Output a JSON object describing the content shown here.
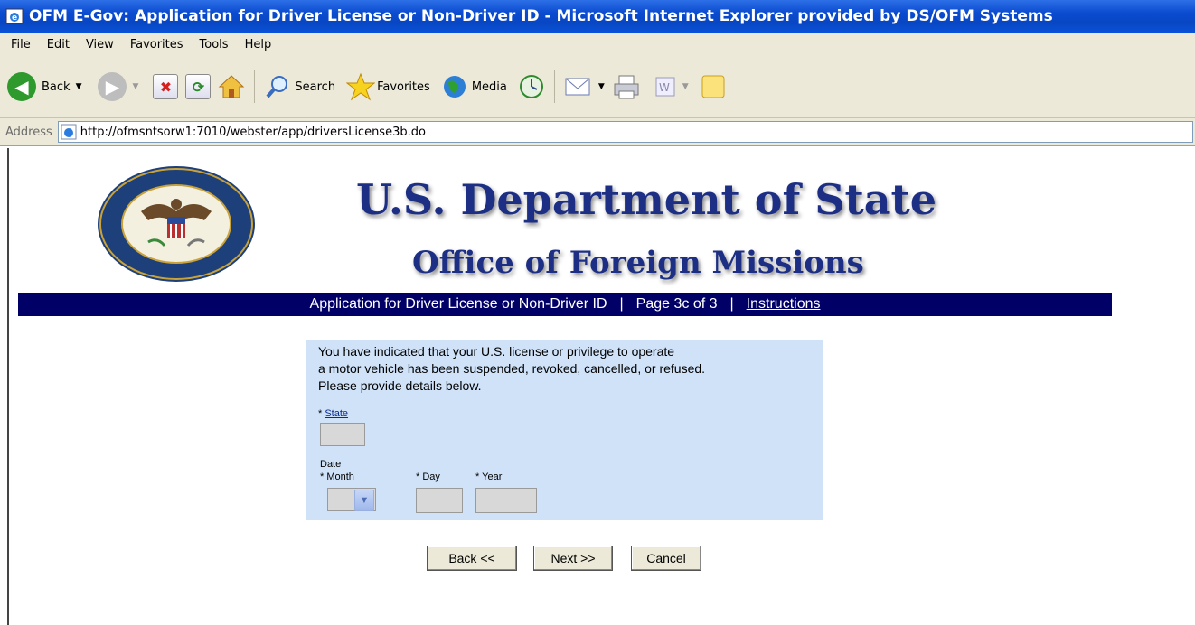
{
  "window": {
    "title": "OFM E-Gov: Application for Driver License or Non-Driver ID - Microsoft Internet Explorer provided by DS/OFM Systems"
  },
  "menu": [
    "File",
    "Edit",
    "View",
    "Favorites",
    "Tools",
    "Help"
  ],
  "toolbar": {
    "back": "Back",
    "search": "Search",
    "favorites": "Favorites",
    "media": "Media"
  },
  "address": {
    "label": "Address",
    "url": "http://ofmsntsorw1:7010/webster/app/driversLicense3b.do"
  },
  "header": {
    "title": "U.S. Department of State",
    "subtitle": "Office of Foreign Missions"
  },
  "nav": {
    "app_name": "Application for Driver License or Non-Driver ID",
    "separator": "|",
    "page": "Page 3c of 3",
    "instructions": "Instructions"
  },
  "form": {
    "intro_lines": [
      "You have indicated that your U.S. license or privilege to operate",
      "a motor vehicle has been suspended, revoked, cancelled, or refused.",
      "Please provide details below."
    ],
    "state_required": "* ",
    "state_label": "State",
    "state_value": "",
    "date_label": "Date",
    "month_label": "* Month",
    "day_label": "* Day",
    "year_label": "* Year",
    "month_value": "",
    "day_value": "",
    "year_value": ""
  },
  "buttons": {
    "back": "Back <<",
    "next": "Next >>",
    "cancel": "Cancel"
  }
}
